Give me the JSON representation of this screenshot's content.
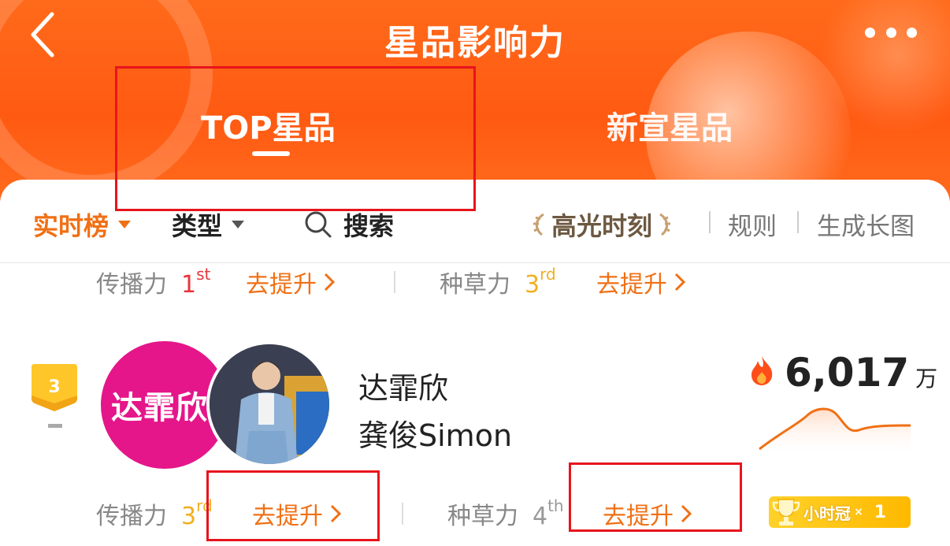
{
  "header": {
    "title": "星品影响力",
    "tabs": [
      {
        "label": "TOP星品",
        "active": true
      },
      {
        "label": "新宣星品",
        "active": false
      }
    ]
  },
  "filters": {
    "realtime": "实时榜",
    "type": "类型",
    "search": "搜索",
    "highlight": "高光时刻",
    "rules": "规则",
    "generate_image": "生成长图"
  },
  "prev_item_stats": {
    "spread_label": "传播力",
    "spread_rank_num": "1",
    "spread_rank_suffix": "st",
    "spread_action": "去提升",
    "grass_label": "种草力",
    "grass_rank_num": "3",
    "grass_rank_suffix": "rd",
    "grass_action": "去提升"
  },
  "item": {
    "rank": "3",
    "brand_logo_text": "达霏欣",
    "brand_name": "达霏欣",
    "celebrity": "龚俊Simon",
    "score": "6,017",
    "score_unit": "万",
    "stats": {
      "spread_label": "传播力",
      "spread_rank_num": "3",
      "spread_rank_suffix": "rd",
      "spread_action": "去提升",
      "grass_label": "种草力",
      "grass_rank_num": "4",
      "grass_rank_suffix": "th",
      "grass_action": "去提升"
    },
    "badge_label": "小时冠",
    "badge_count": "1"
  },
  "colors": {
    "header": "#ff5a12",
    "accent": "#f07015",
    "rank_red": "#e8343c",
    "rank_gold": "#f0b020",
    "brand_pink": "#e4168a"
  },
  "icons": [
    "back-icon",
    "more-icon",
    "caret-down-icon",
    "search-icon",
    "laurel-icon",
    "chevron-right-icon",
    "flame-icon",
    "trophy-icon"
  ]
}
